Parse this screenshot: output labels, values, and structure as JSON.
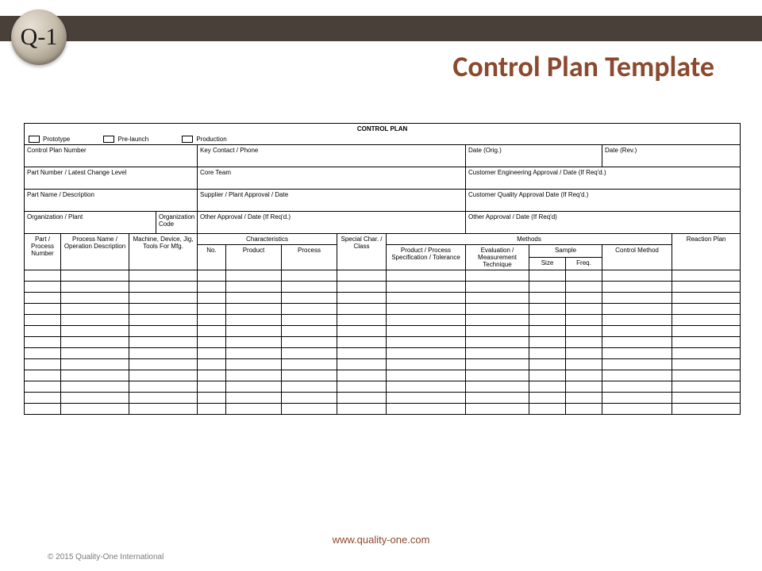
{
  "logo_text": "Q-1",
  "page_title": "Control Plan Template",
  "plan": {
    "title": "CONTROL PLAN",
    "stages": [
      "Prototype",
      "Pre-launch",
      "Production"
    ],
    "info": {
      "control_plan_number": "Control Plan Number",
      "key_contact": "Key Contact / Phone",
      "date_orig": "Date (Orig.)",
      "date_rev": "Date (Rev.)",
      "part_number": "Part Number / Latest Change Level",
      "core_team": "Core Team",
      "cust_eng_approval": "Customer Engineering Approval / Date (If Req'd.)",
      "part_name": "Part Name / Description",
      "supplier_approval": "Supplier / Plant Approval / Date",
      "cust_quality_approval": "Customer Quality Approval Date (If Req'd.)",
      "organization": "Organization / Plant",
      "org_code": "Organization Code",
      "other_approval_1": "Other Approval / Date (If Req'd.)",
      "other_approval_2": "Other Approval / Date (If Req'd)"
    },
    "headers": {
      "part_process_number": "Part / Process Number",
      "process_name": "Process Name / Operation Description",
      "machine": "Machine, Device, Jig, Tools For Mfg.",
      "characteristics": "Characteristics",
      "char_no": "No.",
      "char_product": "Product",
      "char_process": "Process",
      "special_char": "Special Char. / Class",
      "methods": "Methods",
      "prod_spec": "Product / Process Specification / Tolerance",
      "eval_technique": "Evaluation / Measurement Technique",
      "sample": "Sample",
      "sample_size": "Size",
      "sample_freq": "Freq.",
      "control_method": "Control Method",
      "reaction_plan": "Reaction Plan"
    },
    "data_row_count": 13
  },
  "footer": {
    "url": "www.quality-one.com",
    "copyright": "© 2015 Quality-One International"
  }
}
